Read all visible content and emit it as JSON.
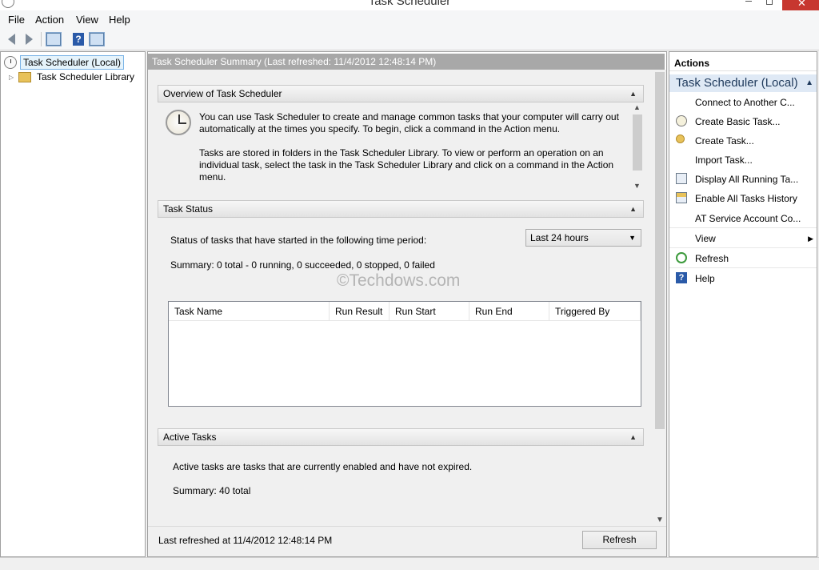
{
  "window": {
    "title": "Task Scheduler"
  },
  "menu": [
    {
      "label": "File"
    },
    {
      "label": "Action"
    },
    {
      "label": "View"
    },
    {
      "label": "Help"
    }
  ],
  "toolbar": {
    "help_glyph": "?"
  },
  "tree": {
    "root": "Task Scheduler (Local)",
    "library": "Task Scheduler Library"
  },
  "center": {
    "header": "Task Scheduler Summary (Last refreshed: 11/4/2012 12:48:14 PM)",
    "overview": {
      "title": "Overview of Task Scheduler",
      "para1": "You can use Task Scheduler to create and manage common tasks that your computer will carry out automatically at the times you specify. To begin, click a command in the Action menu.",
      "para2": "Tasks are stored in folders in the Task Scheduler Library. To view or perform an operation on an individual task, select the task in the Task Scheduler Library and click on a command in the Action menu."
    },
    "status": {
      "title": "Task Status",
      "period_label": "Status of tasks that have started in the following time period:",
      "period_value": "Last 24 hours",
      "summary": "Summary: 0 total - 0 running, 0 succeeded, 0 stopped, 0 failed",
      "watermark": "©Techdows.com",
      "columns": [
        "Task Name",
        "Run Result",
        "Run Start",
        "Run End",
        "Triggered By"
      ]
    },
    "active": {
      "title": "Active Tasks",
      "description": "Active tasks are tasks that are currently enabled and have not expired.",
      "summary": "Summary: 40 total"
    },
    "footer": {
      "last_refreshed": "Last refreshed at 11/4/2012 12:48:14 PM",
      "refresh_label": "Refresh"
    }
  },
  "actions": {
    "heading": "Actions",
    "group": "Task Scheduler (Local)",
    "items": [
      {
        "label": "Connect to Another C...",
        "icon": "none"
      },
      {
        "label": "Create Basic Task...",
        "icon": "basic-task-icon"
      },
      {
        "label": "Create Task...",
        "icon": "create-task-icon"
      },
      {
        "label": "Import Task...",
        "icon": "none"
      },
      {
        "label": "Display All Running Ta...",
        "icon": "running-tasks-icon"
      },
      {
        "label": "Enable All Tasks History",
        "icon": "history-icon"
      },
      {
        "label": "AT Service Account Co...",
        "icon": "none"
      },
      {
        "label": "View",
        "icon": "none"
      },
      {
        "label": "Refresh",
        "icon": "refresh-icon"
      },
      {
        "label": "Help",
        "icon": "help-icon"
      }
    ],
    "help_glyph": "?"
  }
}
